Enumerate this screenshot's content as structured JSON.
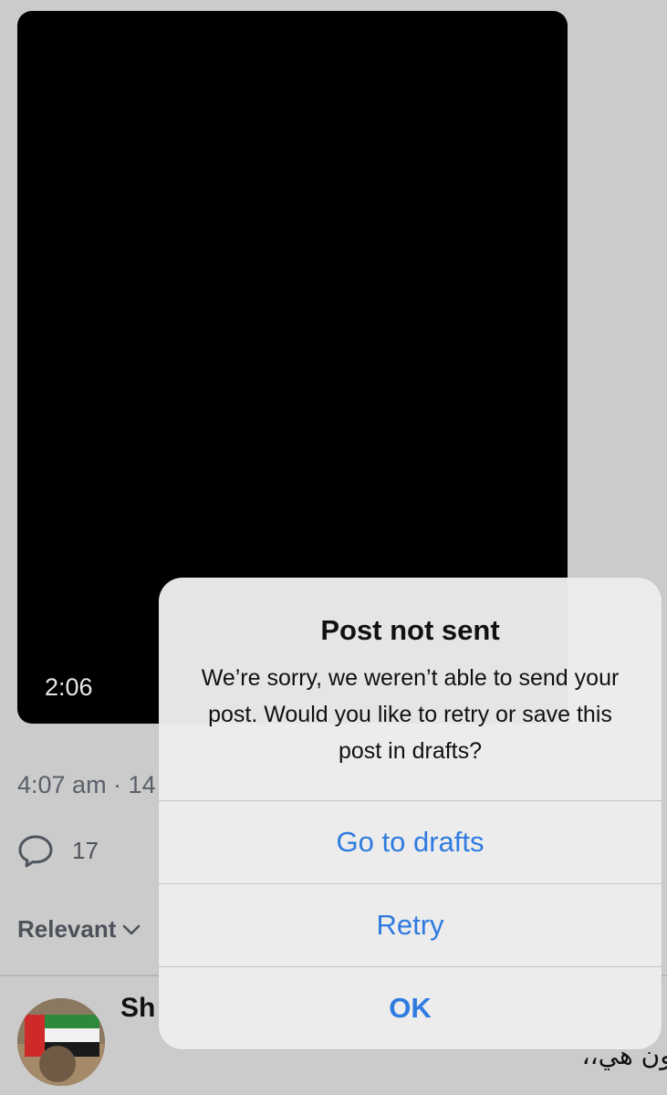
{
  "video": {
    "duration": "2:06"
  },
  "post": {
    "meta": "4:07 am · 14",
    "reply_count": "17"
  },
  "replies": {
    "sort_label": "Relevant",
    "first_reply": {
      "author_partial": "Sh",
      "text_partial": "حون هي،،"
    }
  },
  "alert": {
    "title": "Post not sent",
    "message": "We’re sorry, we weren’t able to send your post. Would you like to retry or save this post in drafts?",
    "buttons": {
      "drafts": "Go to drafts",
      "retry": "Retry",
      "ok": "OK"
    }
  },
  "colors": {
    "accent": "#2f7be0",
    "dim_background": "#cbcbcb"
  }
}
